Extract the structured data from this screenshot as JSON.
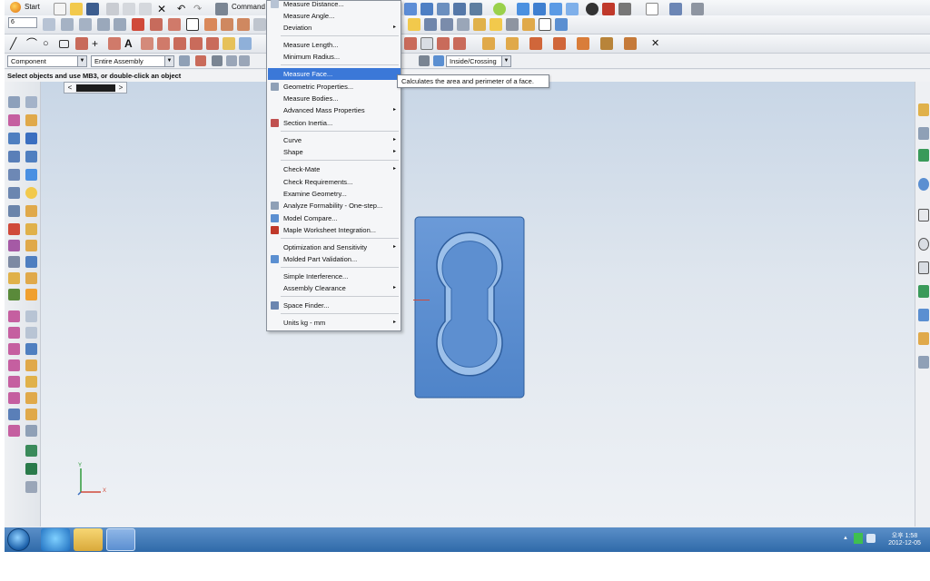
{
  "toolbar": {
    "start_label": "Start",
    "command_label": "Command",
    "layer_value": "6"
  },
  "selection_bar": {
    "filter_value": "Component",
    "scope_value": "Entire Assembly",
    "selection_mode_value": "Inside/Crossing"
  },
  "status": {
    "prompt": "Select objects and use MB3, or double-click an object"
  },
  "menu": {
    "items": [
      {
        "label": "Measure Distance...",
        "submenu": false
      },
      {
        "label": "Measure Angle...",
        "submenu": false
      },
      {
        "label": "Deviation",
        "submenu": true
      },
      {
        "label": "Measure Length...",
        "submenu": false
      },
      {
        "label": "Minimum Radius...",
        "submenu": false
      },
      {
        "label": "Measure Face...",
        "submenu": false,
        "active": true
      },
      {
        "label": "Geometric Properties...",
        "submenu": false
      },
      {
        "label": "Measure Bodies...",
        "submenu": false
      },
      {
        "label": "Advanced Mass Properties",
        "submenu": true
      },
      {
        "label": "Section Inertia...",
        "submenu": false
      },
      {
        "label": "Curve",
        "submenu": true
      },
      {
        "label": "Shape",
        "submenu": true
      },
      {
        "label": "Check-Mate",
        "submenu": true
      },
      {
        "label": "Check Requirements...",
        "submenu": false
      },
      {
        "label": "Examine Geometry...",
        "submenu": false
      },
      {
        "label": "Analyze Formability - One-step...",
        "submenu": false
      },
      {
        "label": "Model Compare...",
        "submenu": false
      },
      {
        "label": "Maple Worksheet Integration...",
        "submenu": false
      },
      {
        "label": "Optimization and Sensitivity",
        "submenu": true
      },
      {
        "label": "Molded Part Validation...",
        "submenu": false
      },
      {
        "label": "Simple Interference...",
        "submenu": false
      },
      {
        "label": "Assembly Clearance",
        "submenu": true
      },
      {
        "label": "Space Finder...",
        "submenu": false
      },
      {
        "label": "Units kg - mm",
        "submenu": true
      }
    ],
    "submenu_arrow": "▸"
  },
  "tooltip": {
    "text": "Calculates the area and perimeter of a face."
  },
  "viewport": {
    "scroll_left": "<",
    "scroll_right": ">",
    "axis_y": "Y",
    "axis_x": "X",
    "part_color": "#5b8fd1",
    "background_top": "#c8d6e6"
  },
  "taskbar": {
    "time": "오후 1:58",
    "date": "2012-12-05",
    "tray_up": "▲"
  },
  "colors": {
    "menu_highlight": "#3b78d8",
    "taskbar": "#2f6aa9"
  }
}
